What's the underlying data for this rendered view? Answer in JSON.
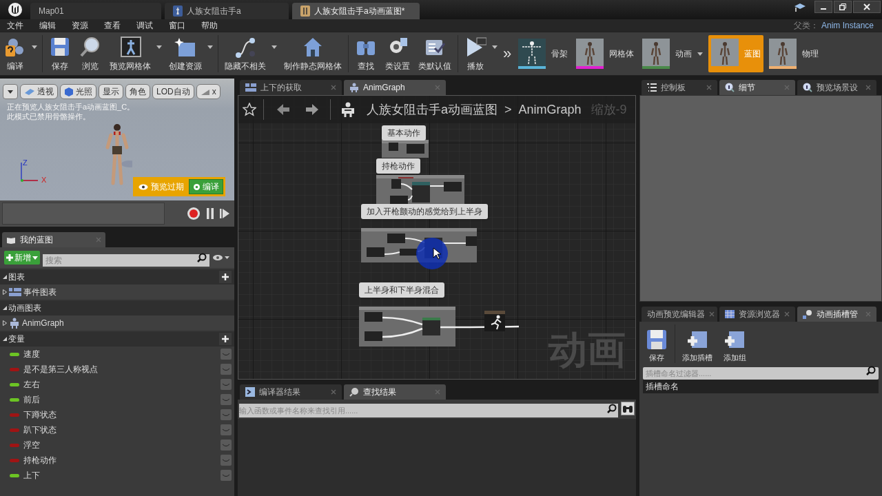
{
  "window": {
    "tabs": [
      {
        "label": "Map01",
        "selected": false
      },
      {
        "label": "人族女阻击手a",
        "selected": false
      },
      {
        "label": "人族女阻击手a动画蓝图*",
        "selected": true
      }
    ]
  },
  "menu": [
    "文件",
    "编辑",
    "资源",
    "查看",
    "调试",
    "窗口",
    "帮助"
  ],
  "parent_class": {
    "label": "父类：",
    "value": "Anim Instance"
  },
  "toolbar": [
    {
      "label": "编译",
      "dropdown": true
    },
    {
      "label": "保存",
      "dropdown": false
    },
    {
      "label": "浏览",
      "dropdown": false
    },
    {
      "label": "预览网格体",
      "dropdown": true
    },
    {
      "label": "创建资源",
      "dropdown": true
    },
    {
      "label": "隐藏不相关",
      "dropdown": true
    },
    {
      "label": "制作静态网格体",
      "dropdown": false
    },
    {
      "label": "查找",
      "dropdown": false
    },
    {
      "label": "类设置",
      "dropdown": false
    },
    {
      "label": "类默认值",
      "dropdown": false
    },
    {
      "label": "播放",
      "dropdown": true
    }
  ],
  "overflow": "»",
  "modes": [
    {
      "kind": "skeleton",
      "label": "骨架",
      "color": "#5ab4d8",
      "selected": false,
      "dropdown": false
    },
    {
      "kind": "mesh",
      "label": "网格体",
      "color": "#e020d0",
      "selected": false,
      "dropdown": false
    },
    {
      "kind": "mesh",
      "label": "动画",
      "color": "#4a8a4a",
      "selected": false,
      "dropdown": true
    },
    {
      "kind": "mesh",
      "label": "蓝图",
      "selected": true,
      "dropdown": false
    },
    {
      "kind": "mesh",
      "label": "物理",
      "color": "#f0b070",
      "selected": false,
      "dropdown": false
    }
  ],
  "viewport": {
    "buttons": [
      "透视",
      "光照",
      "显示",
      "角色",
      "LOD自动",
      "x"
    ],
    "messages": [
      "正在预览人族女阻击手a动画蓝图_C。",
      "此模式已禁用骨骼操作。"
    ],
    "axes": [
      "Z",
      "X"
    ],
    "warning": "预览过期",
    "compile": "编译"
  },
  "my_blueprint": {
    "tab": "我的蓝图",
    "add": "新增",
    "search_placeholder": "搜索",
    "sections": [
      {
        "title": "图表",
        "add": true,
        "items": [
          "事件图表"
        ]
      },
      {
        "title": "动画图表",
        "add": false,
        "items": [
          "AnimGraph"
        ]
      }
    ],
    "variables_title": "变量",
    "variables": [
      {
        "name": "速度",
        "color": "#6cc424"
      },
      {
        "name": "是不是第三人称视点",
        "color": "#a01414"
      },
      {
        "name": "左右",
        "color": "#6cc424"
      },
      {
        "name": "前后",
        "color": "#6cc424"
      },
      {
        "name": "下蹲状态",
        "color": "#a01414"
      },
      {
        "name": "趴下状态",
        "color": "#a01414"
      },
      {
        "name": "浮空",
        "color": "#a01414"
      },
      {
        "name": "持枪动作",
        "color": "#a01414"
      },
      {
        "name": "上下",
        "color": "#6cc424"
      }
    ]
  },
  "graph": {
    "tabs": [
      {
        "label": "上下的获取",
        "selected": false
      },
      {
        "label": "AnimGraph",
        "selected": true
      }
    ],
    "breadcrumb": {
      "asset": "人族女阻击手a动画蓝图",
      "separator": ">",
      "graph": "AnimGraph",
      "zoom": "缩放-9"
    },
    "comments": [
      "基本动作",
      "持枪动作",
      "加入开枪颤动的感觉给到上半身",
      "上半身和下半身混合"
    ],
    "graph_type": "动画"
  },
  "results": {
    "tabs": [
      {
        "label": "编译器结果",
        "selected": false
      },
      {
        "label": "查找结果",
        "selected": true
      }
    ],
    "search_placeholder": "输入函数或事件名称来查找引用......"
  },
  "details": {
    "tabs": [
      {
        "label": "控制板",
        "selected": false
      },
      {
        "label": "细节",
        "selected": true
      },
      {
        "label": "预览场景设",
        "selected": false
      }
    ]
  },
  "slots": {
    "tabs": [
      {
        "label": "动画预览编辑器",
        "selected": false
      },
      {
        "label": "资源浏览器",
        "selected": false
      },
      {
        "label": "动画插槽管",
        "selected": true
      }
    ],
    "buttons": [
      "保存",
      "添加插槽",
      "添加组"
    ],
    "filter_placeholder": "插槽命名过滤器......",
    "header": "插槽命名"
  }
}
